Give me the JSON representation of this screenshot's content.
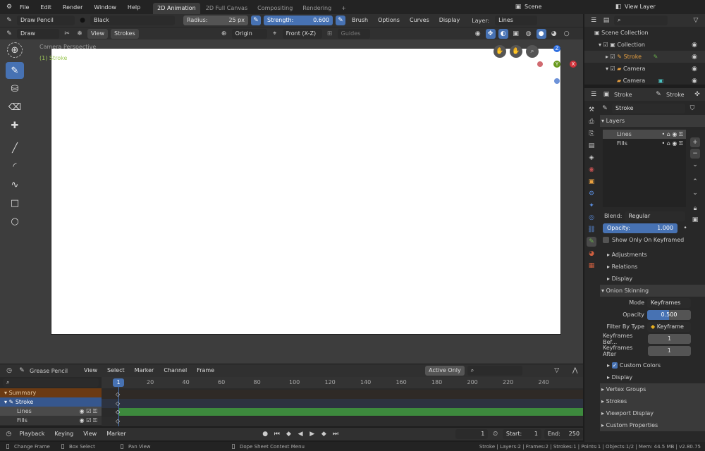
{
  "menu": {
    "items": [
      "File",
      "Edit",
      "Render",
      "Window",
      "Help"
    ]
  },
  "workspaces": {
    "tabs": [
      "2D Animation",
      "2D Full Canvas",
      "Compositing",
      "Rendering"
    ],
    "add": "+"
  },
  "scene": {
    "label": "Scene",
    "view_layer": "View Layer"
  },
  "tool_settings": {
    "tool": "Draw Pencil",
    "material": "Black",
    "radius_label": "Radius:",
    "radius_value": "25 px",
    "strength_label": "Strength:",
    "strength_value": "0.600",
    "brush": "Brush",
    "options": "Options",
    "curves": "Curves",
    "display": "Display",
    "layer_label": "Layer:",
    "layer_value": "Lines"
  },
  "viewport_header": {
    "mode": "Draw",
    "view": "View",
    "strokes": "Strokes",
    "origin": "Origin",
    "orientation": "Front (X-Z)",
    "guides": "Guides"
  },
  "viewport": {
    "camera_label": "Camera Perspective",
    "object_label": "(1) Stroke",
    "gizmo": {
      "z": "Z",
      "y": "Y",
      "x": "X"
    }
  },
  "outliner": {
    "title": "Scene Collection",
    "items": [
      {
        "label": "Collection"
      },
      {
        "label": "Stroke"
      },
      {
        "label": "Camera"
      },
      {
        "label": "Camera"
      }
    ],
    "search_placeholder": ""
  },
  "properties": {
    "header_object": "Stroke",
    "header_data": "Stroke",
    "datablock": "Stroke",
    "layers_title": "Layers",
    "layers": [
      {
        "name": "Lines"
      },
      {
        "name": "Fills"
      }
    ],
    "blend_label": "Blend:",
    "blend_value": "Regular",
    "opacity_label": "Opacity:",
    "opacity_value": "1.000",
    "opacity_fill": 1.0,
    "show_only_keyframed": "Show Only On Keyframed",
    "sub_adjustments": "Adjustments",
    "sub_relations": "Relations",
    "sub_display": "Display",
    "onion_title": "Onion Skinning",
    "onion_mode_label": "Mode",
    "onion_mode_value": "Keyframes",
    "onion_opacity_label": "Opacity",
    "onion_opacity_value": "0.500",
    "onion_opacity_fill": 0.5,
    "filter_label": "Filter By Type",
    "filter_value": "Keyframe",
    "kf_before_label": "Keyframes Bef...",
    "kf_before_value": "1",
    "kf_after_label": "Keyframes After",
    "kf_after_value": "1",
    "custom_colors": "Custom Colors",
    "onion_display": "Display",
    "vertex_groups": "Vertex Groups",
    "strokes": "Strokes",
    "viewport_display": "Viewport Display",
    "custom_properties": "Custom Properties"
  },
  "dopesheet": {
    "mode": "Grease Pencil",
    "view": "View",
    "select": "Select",
    "marker": "Marker",
    "channel": "Channel",
    "frame": "Frame",
    "active_only": "Active Only",
    "channels": [
      {
        "label": "Summary"
      },
      {
        "label": "Stroke"
      },
      {
        "label": "Lines"
      },
      {
        "label": "Fills"
      }
    ],
    "current_frame": "1",
    "ticks": [
      "20",
      "40",
      "60",
      "80",
      "100",
      "120",
      "140",
      "160",
      "180",
      "200",
      "220",
      "240"
    ]
  },
  "timeline": {
    "playback": "Playback",
    "keying": "Keying",
    "view": "View",
    "marker": "Marker",
    "frame": "1",
    "start_label": "Start:",
    "start_value": "1",
    "end_label": "End:",
    "end_value": "250"
  },
  "statusbar": {
    "left1": "Change Frame",
    "left2": "Box Select",
    "left3": "Pan View",
    "context": "Dope Sheet Context Menu",
    "stats": "Stroke | Layers:2 | Frames:2 | Strokes:1 | Points:1 | Objects:1/2 | Mem: 44.5 MB | v2.80.75"
  },
  "colors": {
    "accent": "#4772b3",
    "keyframe_bar": "#3d8a3d",
    "summary": "#6b3a13",
    "stroke_object": "#e8a040"
  }
}
